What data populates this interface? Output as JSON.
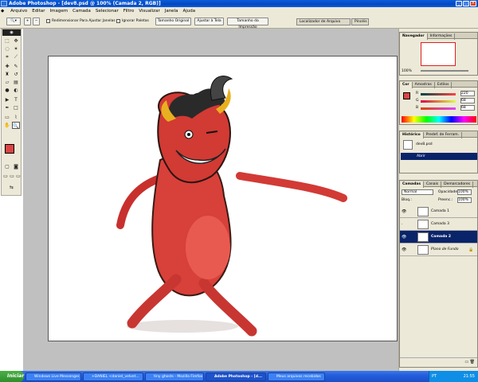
{
  "window": {
    "title": "Adobe Photoshop - [dev8.psd @ 100% (Camada 2, RGB)]"
  },
  "menu": [
    "Arquivo",
    "Editar",
    "Imagem",
    "Camada",
    "Selecionar",
    "Filtro",
    "Visualizar",
    "Janela",
    "Ajuda"
  ],
  "options": {
    "resize_windows": "Redimensionar Para Ajustar Janelas",
    "ignore_palettes": "Ignorar Paletas",
    "actual_size": "Tamanho Original",
    "fit_screen": "Ajustar à Tela",
    "print_size": "Tamanho da Impressão",
    "tab_file_browser": "Localizador de Arquivo",
    "tab_brushes": "Pincéis"
  },
  "navigator": {
    "tabs": [
      "Navegador",
      "Informações"
    ],
    "zoom": "100%"
  },
  "color": {
    "tabs": [
      "Cor",
      "Amostras",
      "Estilos"
    ],
    "r_label": "R",
    "g_label": "G",
    "b_label": "B",
    "r": "220",
    "g": "68",
    "b": "68",
    "fg": "#dc4444"
  },
  "history": {
    "tabs": [
      "Histórico",
      "Predef. de Ferram."
    ],
    "items": [
      "dev8.psd",
      "Abrir"
    ]
  },
  "layers": {
    "tabs": [
      "Camadas",
      "Canais",
      "Demarcadores"
    ],
    "mode": "Normal",
    "opacity_label": "Opacidade:",
    "opacity": "100%",
    "lock_label": "Bloq.:",
    "fill_label": "Preenc.:",
    "fill": "100%",
    "items": [
      "Camada 1",
      "Camada 3",
      "Camada 2",
      "Plano de Fundo"
    ]
  },
  "taskbar": {
    "start": "Iniciar",
    "tasks": [
      "Windows Live Messenger...",
      "+DANIEL <daniel_velvet...",
      "tiny ghosts - Mozilla Firefox",
      "Adobe Photoshop - [d...",
      "Meus arquivos recebidos"
    ],
    "lang": "PT",
    "time": "21:55"
  }
}
